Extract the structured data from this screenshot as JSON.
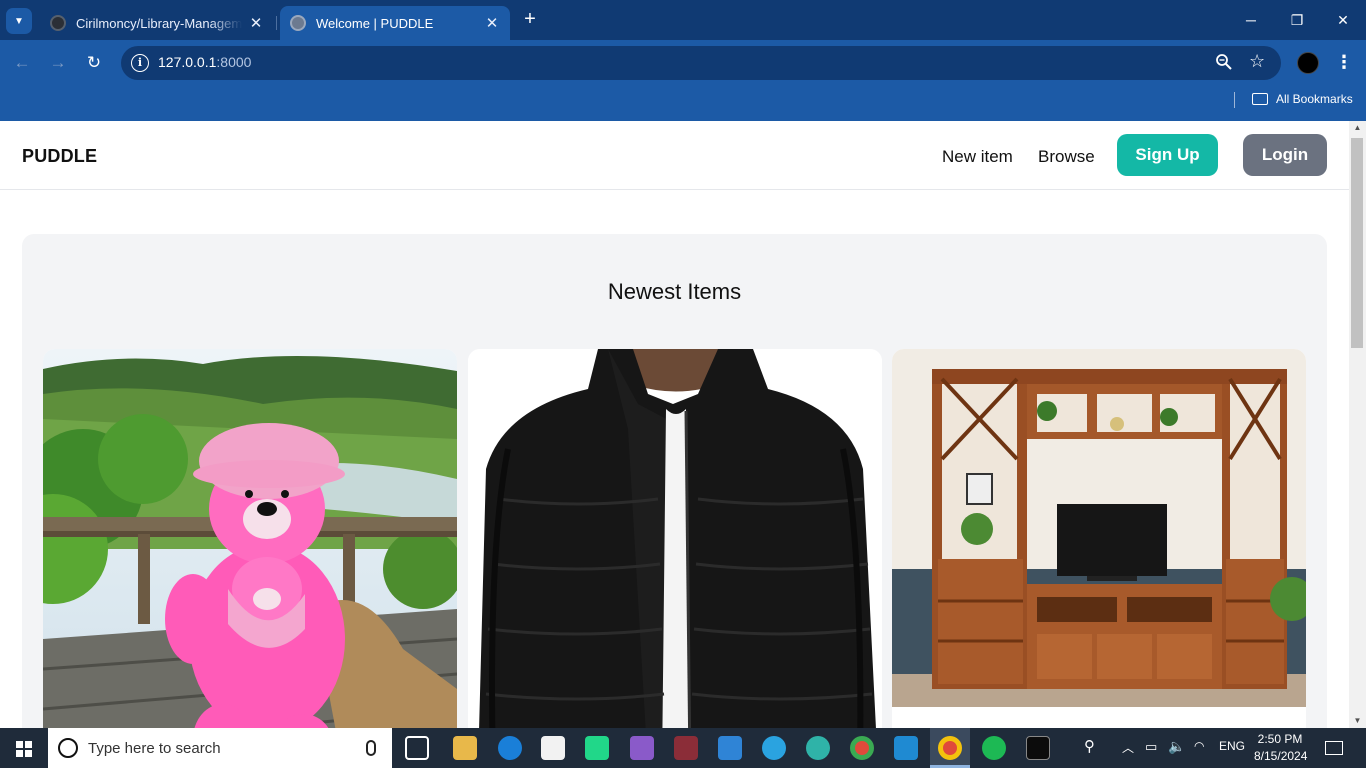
{
  "browser": {
    "tabs": [
      {
        "title": "Cirilmoncy/Library-Management",
        "close_icon": "close-icon"
      },
      {
        "title": "Welcome | PUDDLE",
        "close_icon": "close-icon"
      }
    ],
    "new_tab_icon": "plus-icon",
    "url": {
      "host": "127.0.0.1",
      "port": ":8000"
    },
    "bookmarks_label": "All Bookmarks"
  },
  "site": {
    "logo": "PUDDLE",
    "nav": {
      "new_item": "New item",
      "browse": "Browse",
      "signup": "Sign Up",
      "login": "Login"
    },
    "colors": {
      "signup": "#14b8a6",
      "login": "#6b7280",
      "panel": "#f3f4f6"
    },
    "newest": {
      "title": "Newest Items",
      "items": [
        {
          "image": "pink teddy bear on balcony"
        },
        {
          "image": "black puffer jacket"
        },
        {
          "image": "wooden TV entertainment unit"
        }
      ]
    }
  },
  "taskbar": {
    "search_placeholder": "Type here to search",
    "lang": "ENG",
    "time": "2:50 PM",
    "date": "8/15/2024"
  }
}
